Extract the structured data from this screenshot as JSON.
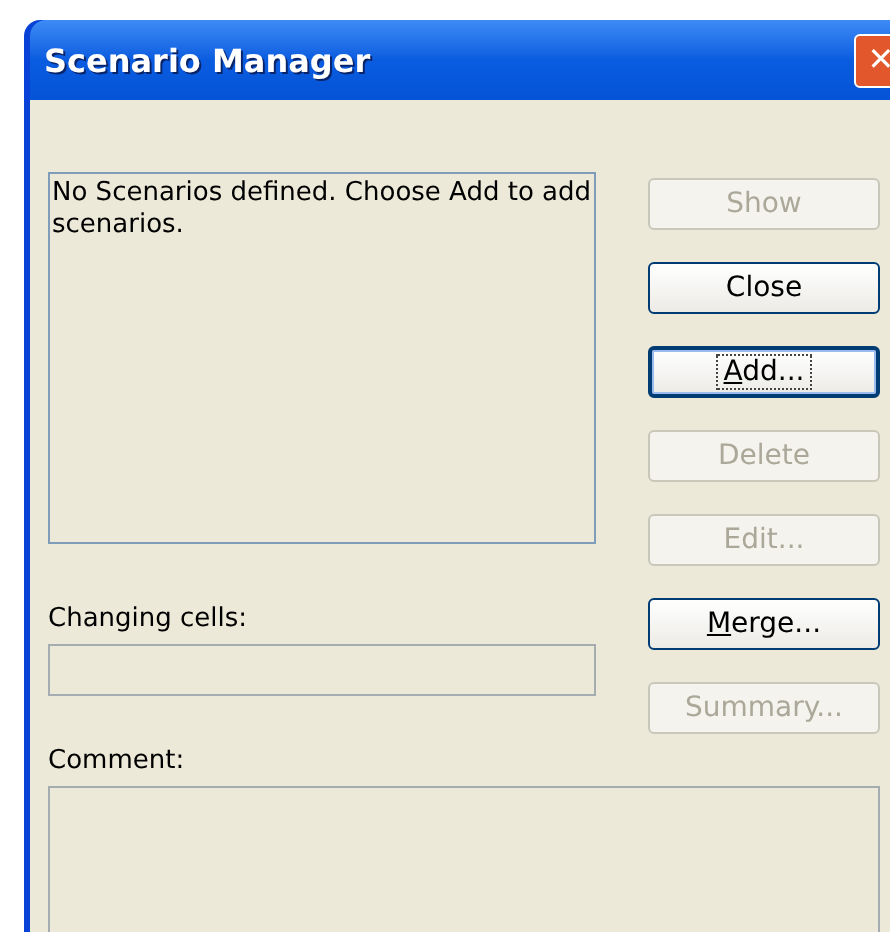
{
  "window": {
    "title": "Scenario Manager",
    "close_label": "✕"
  },
  "scenarios_list": {
    "message": "No Scenarios defined. Choose Add to add scenarios."
  },
  "changing_cells": {
    "label": "Changing cells:"
  },
  "comment": {
    "label": "Comment:"
  },
  "buttons": [
    {
      "label": "Show",
      "disabled": true,
      "focused": false,
      "underline_first": false
    },
    {
      "label": "Close",
      "disabled": false,
      "focused": false,
      "underline_first": false
    },
    {
      "label": "Add...",
      "disabled": false,
      "focused": true,
      "underline_first": true
    },
    {
      "label": "Delete",
      "disabled": true,
      "focused": false,
      "underline_first": false
    },
    {
      "label": "Edit...",
      "disabled": true,
      "focused": false,
      "underline_first": false
    },
    {
      "label": "Merge...",
      "disabled": false,
      "focused": false,
      "underline_first": true
    },
    {
      "label": "Summary...",
      "disabled": true,
      "focused": false,
      "underline_first": false
    }
  ]
}
